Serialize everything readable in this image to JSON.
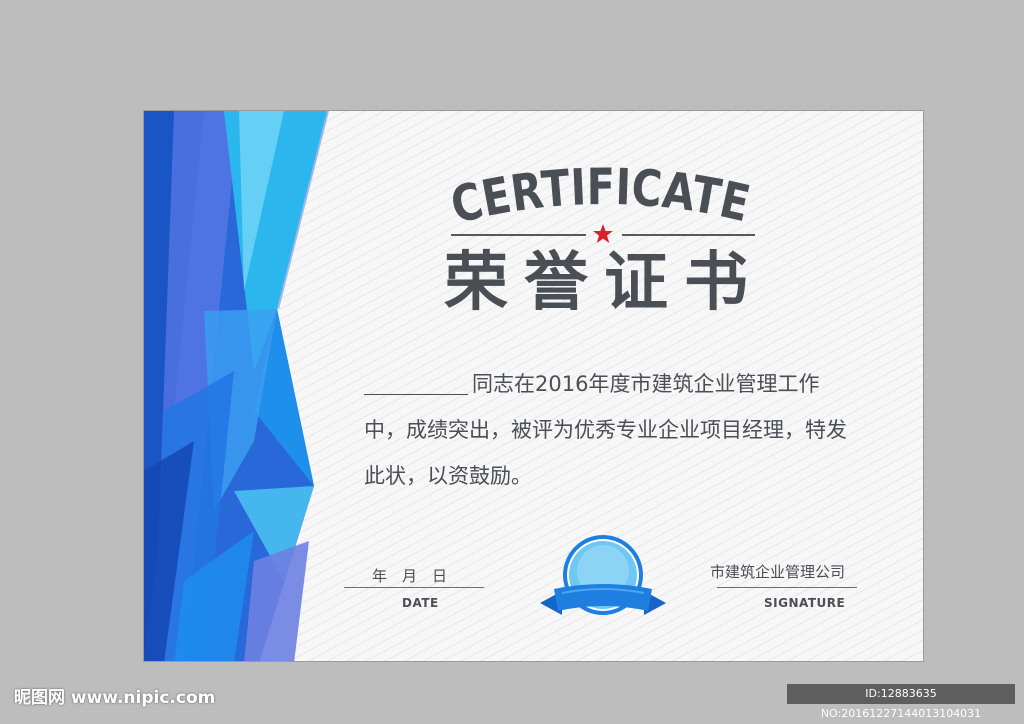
{
  "certificate": {
    "title_en": "CERTIFICATE",
    "title_cn": "荣誉证书",
    "body": "同志在2016年度市建筑企业管理工作中，成绩突出，被评为优秀专业企业项目经理，特发此状，以资鼓励。",
    "date_label": "年　月　日",
    "date_caption": "DATE",
    "org_name": "市建筑企业管理公司",
    "signature_caption": "SIGNATURE"
  },
  "watermark": {
    "site": "昵图网 www.nipic.com",
    "id_text": "ID:12883635 NO:20161227144013104031"
  },
  "colors": {
    "accent_blue": "#1e7fe0",
    "star_red": "#d9232a",
    "text_gray": "#4a4f56"
  }
}
